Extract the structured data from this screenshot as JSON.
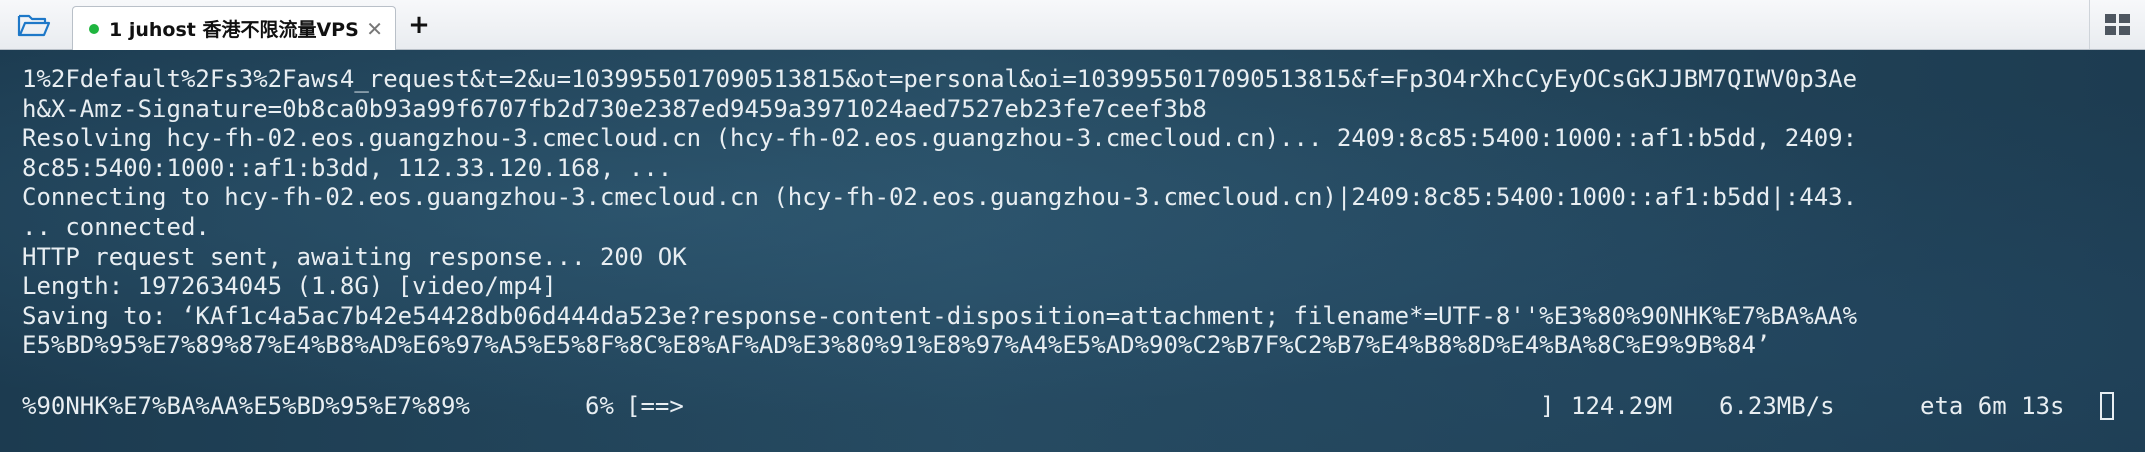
{
  "tabbar": {
    "open_icon": "folder-open-icon",
    "tabs": [
      {
        "label": "1 juhost 香港不限流量VPS",
        "status_color": "#1fb53f",
        "close_glyph": "✕"
      }
    ],
    "new_tab_glyph": "+",
    "layout_icon": "grid-layout-icon"
  },
  "terminal": {
    "lines": [
      "1%2Fdefault%2Fs3%2Faws4_request&t=2&u=1039955017090513815&ot=personal&oi=1039955017090513815&f=Fp3O4rXhcCyEyOCsGKJJBM7QIWV0p3Ae",
      "h&X-Amz-Signature=0b8ca0b93a99f6707fb2d730e2387ed9459a3971024aed7527eb23fe7ceef3b8",
      "Resolving hcy-fh-02.eos.guangzhou-3.cmecloud.cn (hcy-fh-02.eos.guangzhou-3.cmecloud.cn)... 2409:8c85:5400:1000::af1:b5dd, 2409:",
      "8c85:5400:1000::af1:b3dd, 112.33.120.168, ...",
      "Connecting to hcy-fh-02.eos.guangzhou-3.cmecloud.cn (hcy-fh-02.eos.guangzhou-3.cmecloud.cn)|2409:8c85:5400:1000::af1:b5dd|:443.",
      ".. connected.",
      "HTTP request sent, awaiting response... 200 OK",
      "Length: 1972634045 (1.8G) [video/mp4]",
      "Saving to: ‘KAf1c4a5ac7b42e54428db06d444da523e?response-content-disposition=attachment; filename*=UTF-8''%E3%80%90NHK%E7%BA%AA%",
      "E5%BD%95%E7%89%87%E4%B8%AD%E6%97%A5%E5%8F%8C%E8%AF%AD%E3%80%91%E8%97%A4%E5%AD%90%C2%B7F%C2%B7%E4%B8%8D%E4%BA%8C%E9%9B%84’",
      ""
    ],
    "progress": {
      "filename": "%90NHK%E7%BA%AA%E5%BD%95%E7%89%",
      "percent_text": "6%",
      "percent": 6,
      "bar": "[==>",
      "bar_end": "]",
      "downloaded": "124.29M",
      "speed": "6.23MB/s",
      "eta": "eta 6m 13s"
    }
  }
}
